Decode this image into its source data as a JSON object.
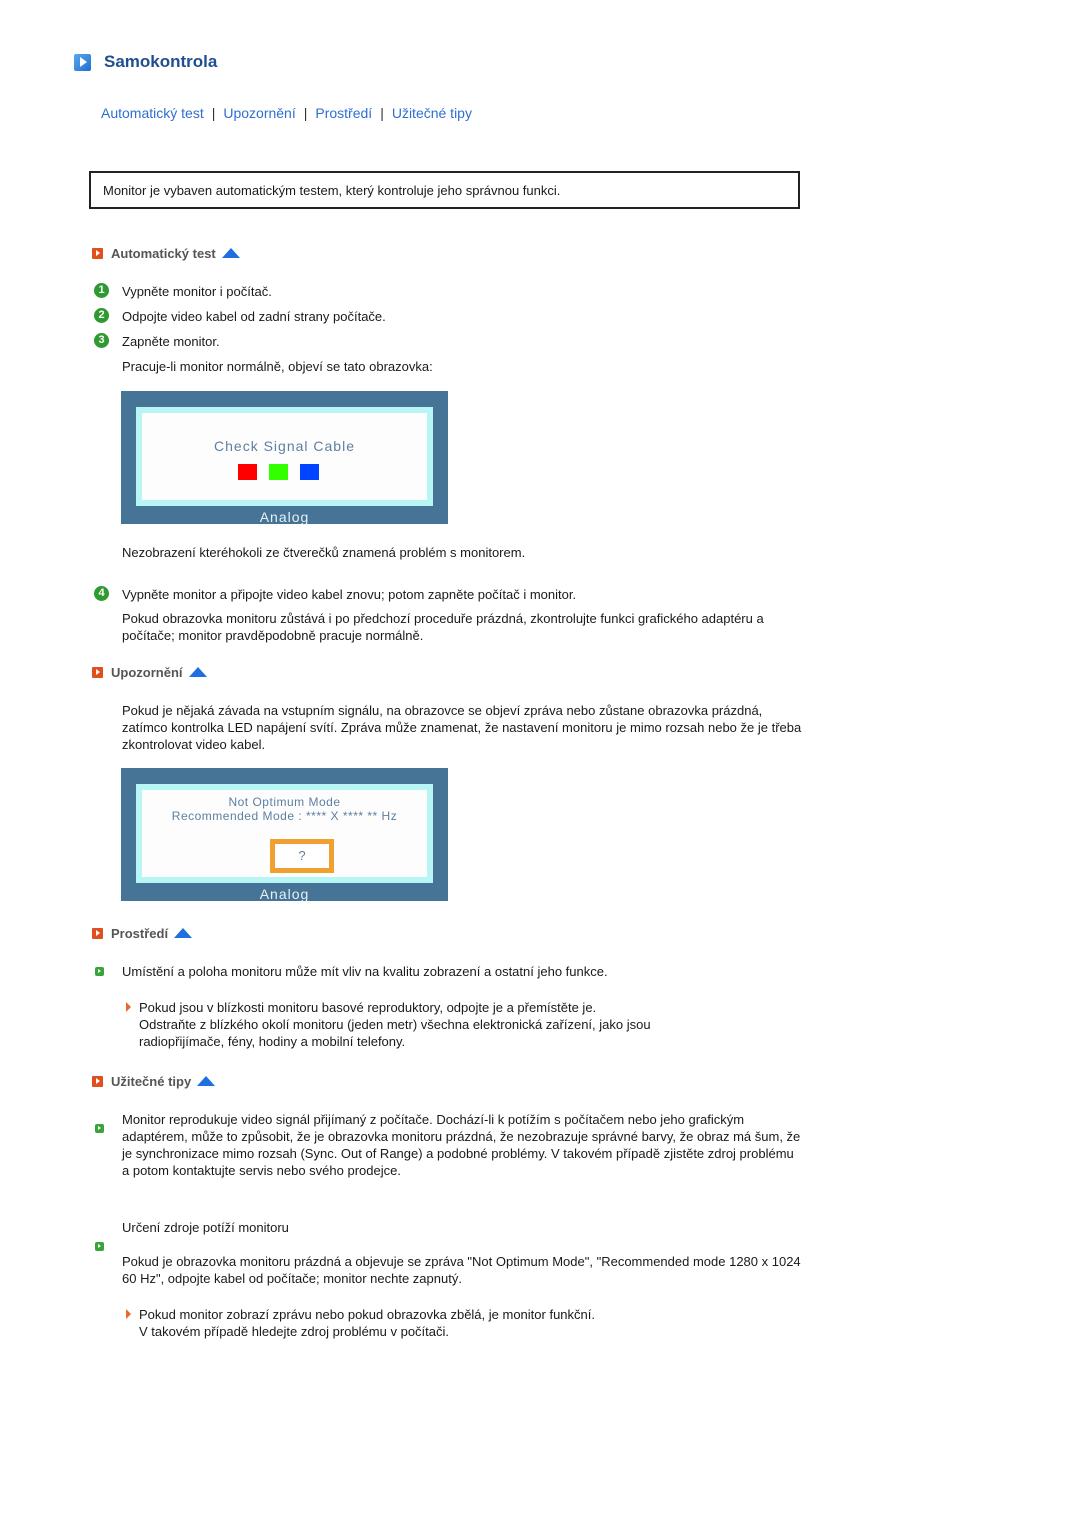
{
  "page": {
    "title": "Samokontrola",
    "nav": [
      "Automatický test",
      "Upozornění",
      "Prostředí",
      "Užitečné tipy"
    ],
    "nav_separator": "|",
    "intro": "Monitor je vybaven automatickým testem, který kontroluje jeho správnou funkci."
  },
  "sections": {
    "auto_test": {
      "heading": "Automatický test",
      "steps": [
        {
          "num": "1",
          "text": "Vypněte monitor i počítač."
        },
        {
          "num": "2",
          "text": "Odpojte video kabel od zadní strany počítače."
        },
        {
          "num": "3",
          "text": "Zapněte monitor."
        }
      ],
      "step3_note": "Pracuje-li monitor normálně, objeví se tato obrazovka:",
      "screen": {
        "title": "Check Signal Cable",
        "squares": [
          "#ff0000",
          "#33ff00",
          "#0044ff"
        ],
        "label": "Analog"
      },
      "after_screen": "Nezobrazení kteréhokoli ze čtverečků znamená problém s monitorem.",
      "step4": {
        "num": "4",
        "text": "Vypněte monitor a připojte video kabel znovu; potom zapněte počítač i monitor."
      },
      "step4_note": "Pokud obrazovka monitoru zůstává i po předchozí proceduře prázdná, zkontrolujte funkci grafického adaptéru a počítače; monitor pravděpodobně pracuje normálně."
    },
    "warning": {
      "heading": "Upozornění",
      "text": "Pokud je nějaká závada na vstupním signálu, na obrazovce se objeví zpráva nebo zůstane obrazovka prázdná, zatímco kontrolka LED napájení svítí. Zpráva může znamenat, že nastavení monitoru je mimo rozsah nebo že je třeba zkontrolovat video kabel.",
      "screen": {
        "line1": "Not Optimum Mode",
        "line2": "Recommended Mode : **** X **** ** Hz",
        "button": "?",
        "label": "Analog"
      }
    },
    "environment": {
      "heading": "Prostředí",
      "bullet": "Umístění a poloha monitoru může mít vliv na kvalitu zobrazení a ostatní jeho funkce.",
      "sub_line1": "Pokud jsou v blízkosti monitoru basové reproduktory, odpojte je a přemístěte je.",
      "sub_line2": "Odstraňte z blízkého okolí monitoru (jeden metr) všechna elektronická zařízení, jako jsou radiopřijímače, fény, hodiny a mobilní telefony."
    },
    "tips": {
      "heading": "Užitečné tipy",
      "bullet1": "Monitor reprodukuje video signál přijímaný z počítače. Dochází-li k potížím s počítačem nebo jeho grafickým adaptérem, může to způsobit, že je obrazovka monitoru prázdná, že nezobrazuje správné barvy, že obraz má šum, že je synchronizace mimo rozsah (Sync. Out of Range) a podobné problémy. V takovém případě zjistěte zdroj problému a potom kontaktujte servis nebo svého prodejce.",
      "bullet2": "Určení zdroje potíží monitoru",
      "bullet2_note": "Pokud je obrazovka monitoru prázdná a objevuje se zpráva \"Not Optimum Mode\", \"Recommended mode 1280 x 1024 60 Hz\", odpojte kabel od počítače; monitor nechte zapnutý.",
      "sub_line1": "Pokud monitor zobrazí zprávu nebo pokud obrazovka zbělá, je monitor funkční.",
      "sub_line2": "V takovém případě hledejte zdroj problému v počítači."
    }
  }
}
